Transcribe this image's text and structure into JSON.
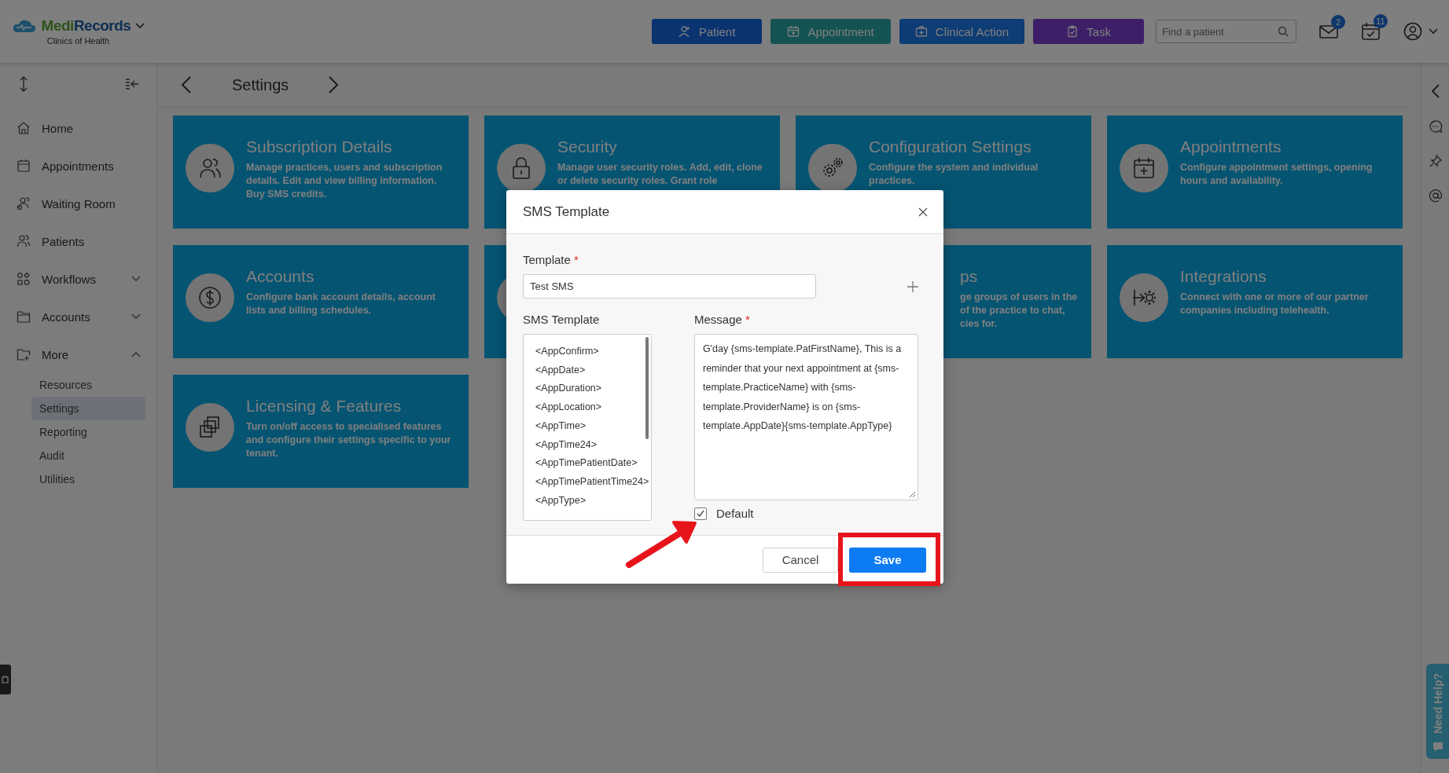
{
  "app": {
    "logo_first": "Medi",
    "logo_second": "Records",
    "subtitle": "Clinics of Health"
  },
  "header": {
    "actions": [
      {
        "label": "Patient",
        "kind": "patient"
      },
      {
        "label": "Appointment",
        "kind": "appointment"
      },
      {
        "label": "Clinical Action",
        "kind": "clinical"
      },
      {
        "label": "Task",
        "kind": "task"
      }
    ],
    "search": {
      "placeholder": "Find a patient"
    },
    "notifications": [
      {
        "kind": "mail",
        "count": "2"
      },
      {
        "kind": "tasks",
        "count": "11"
      }
    ]
  },
  "sidebar": {
    "items": [
      {
        "label": "Home",
        "kind": "home",
        "selected": false
      },
      {
        "label": "Appointments",
        "kind": "calendar",
        "selected": false
      },
      {
        "label": "Waiting Room",
        "kind": "waiting",
        "selected": false
      },
      {
        "label": "Patients",
        "kind": "users",
        "selected": false
      },
      {
        "label": "Workflows",
        "kind": "workflow",
        "selected": false,
        "expanded": false
      },
      {
        "label": "Accounts",
        "kind": "folder",
        "selected": false,
        "expanded": false
      },
      {
        "label": "More",
        "kind": "folder-plus",
        "selected": false,
        "expanded": true,
        "children": [
          {
            "label": "Resources",
            "selected": false
          },
          {
            "label": "Settings",
            "selected": true
          },
          {
            "label": "Reporting",
            "selected": false
          },
          {
            "label": "Audit",
            "selected": false
          },
          {
            "label": "Utilities",
            "selected": false
          }
        ]
      }
    ]
  },
  "page": {
    "title": "Settings"
  },
  "cards": [
    {
      "kind": "users",
      "title": "Subscription Details",
      "lines": [
        "Manage practices, users and subscription",
        "details. Edit and view billing information.",
        "Buy SMS credits."
      ]
    },
    {
      "kind": "lock",
      "title": "Security",
      "lines": [
        "Manage user security roles. Add, edit, clone",
        "or delete security roles. Grant role"
      ]
    },
    {
      "kind": "gears",
      "title": "Configuration Settings",
      "lines": [
        "Configure the system and individual",
        "practices."
      ]
    },
    {
      "kind": "calendar",
      "title": "Appointments",
      "lines": [
        "Configure appointment settings, opening",
        "hours and availability."
      ]
    },
    {
      "kind": "dollar",
      "title": "Accounts",
      "lines": [
        "Configure bank account details, account",
        "lists and billing schedules."
      ]
    },
    {
      "kind": "covered-icon"
    },
    {
      "kind": "covered",
      "title": "ps",
      "lines": [
        "ge groups of users in the",
        "of the practice to chat,",
        "cies for."
      ]
    },
    {
      "kind": "integration",
      "title": "Integrations",
      "lines": [
        "Connect with one or more of our partner",
        "companies including telehealth."
      ]
    },
    {
      "kind": "squares",
      "title": "Licensing & Features",
      "lines": [
        "Turn on/off access to specialised features",
        "and configure their settings specific to your",
        "tenant."
      ]
    }
  ],
  "dialog": {
    "title": "SMS Template",
    "template_field": {
      "label": "Template",
      "required_mark": "*",
      "value": "Test SMS"
    },
    "list": {
      "label": "SMS Template",
      "items": [
        "<AppConfirm>",
        "<AppDate>",
        "<AppDuration>",
        "<AppLocation>",
        "<AppTime>",
        "<AppTime24>",
        "<AppTimePatientDate>",
        "<AppTimePatientTime24>",
        "<AppType>"
      ]
    },
    "message": {
      "label": "Message",
      "required_mark": "*",
      "value": "G'day {sms-template.PatFirstName}, This is a reminder that your next appointment at {sms-template.PracticeName} with {sms-template.ProviderName} is on {sms-template.AppDate}{sms-template.AppType}"
    },
    "default": {
      "label": "Default",
      "checked": true
    },
    "buttons": [
      {
        "label": "Cancel",
        "kind": "secondary"
      },
      {
        "label": "Save",
        "kind": "primary"
      }
    ]
  },
  "help_tab": {
    "label": "Need Help?"
  }
}
